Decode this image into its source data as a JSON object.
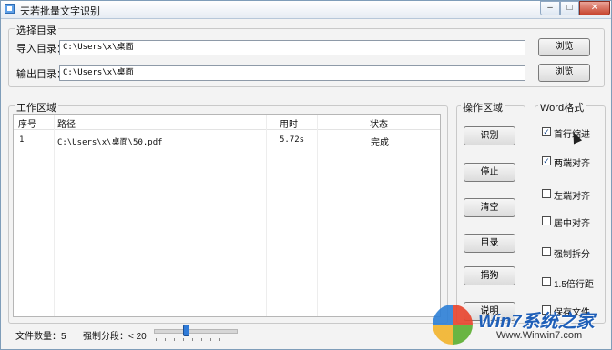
{
  "window": {
    "title": "天若批量文字识别",
    "min_glyph": "–",
    "max_glyph": "□",
    "close_glyph": "✕"
  },
  "select_dir": {
    "legend": "选择目录",
    "import_label": "导入目录：",
    "import_value": "C:\\Users\\x\\桌面",
    "output_label": "输出目录：",
    "output_value": "C:\\Users\\x\\桌面",
    "browse_label": "浏览"
  },
  "work_area": {
    "legend": "工作区域",
    "columns": [
      "序号",
      "路径",
      "用时",
      "状态"
    ],
    "rows": [
      {
        "index": "1",
        "path": "C:\\Users\\x\\桌面\\50.pdf",
        "time": "5.72s",
        "status": "完成"
      }
    ]
  },
  "operation_area": {
    "legend": "操作区域",
    "buttons": [
      "识别",
      "停止",
      "清空",
      "目录",
      "捐狗",
      "说明"
    ]
  },
  "word_format": {
    "legend": "Word格式",
    "options": [
      {
        "label": "首行缩进",
        "checked": true
      },
      {
        "label": "两端对齐",
        "checked": true
      },
      {
        "label": "左端对齐",
        "checked": false
      },
      {
        "label": "居中对齐",
        "checked": false
      },
      {
        "label": "强制拆分",
        "checked": false
      },
      {
        "label": "1.5倍行距",
        "checked": false
      },
      {
        "label": "保存文件",
        "checked": false
      }
    ],
    "check_mark": "✓"
  },
  "footer": {
    "file_count_label": "文件数量：5",
    "force_split_label": "强制分段：< 20",
    "slider_value": 0.4
  },
  "watermark": {
    "brand": "Win7系统之家",
    "url": "Www.Winwin7.com"
  },
  "colors": {
    "accent": "#2f7bd8",
    "close_button": "#c7452f"
  }
}
